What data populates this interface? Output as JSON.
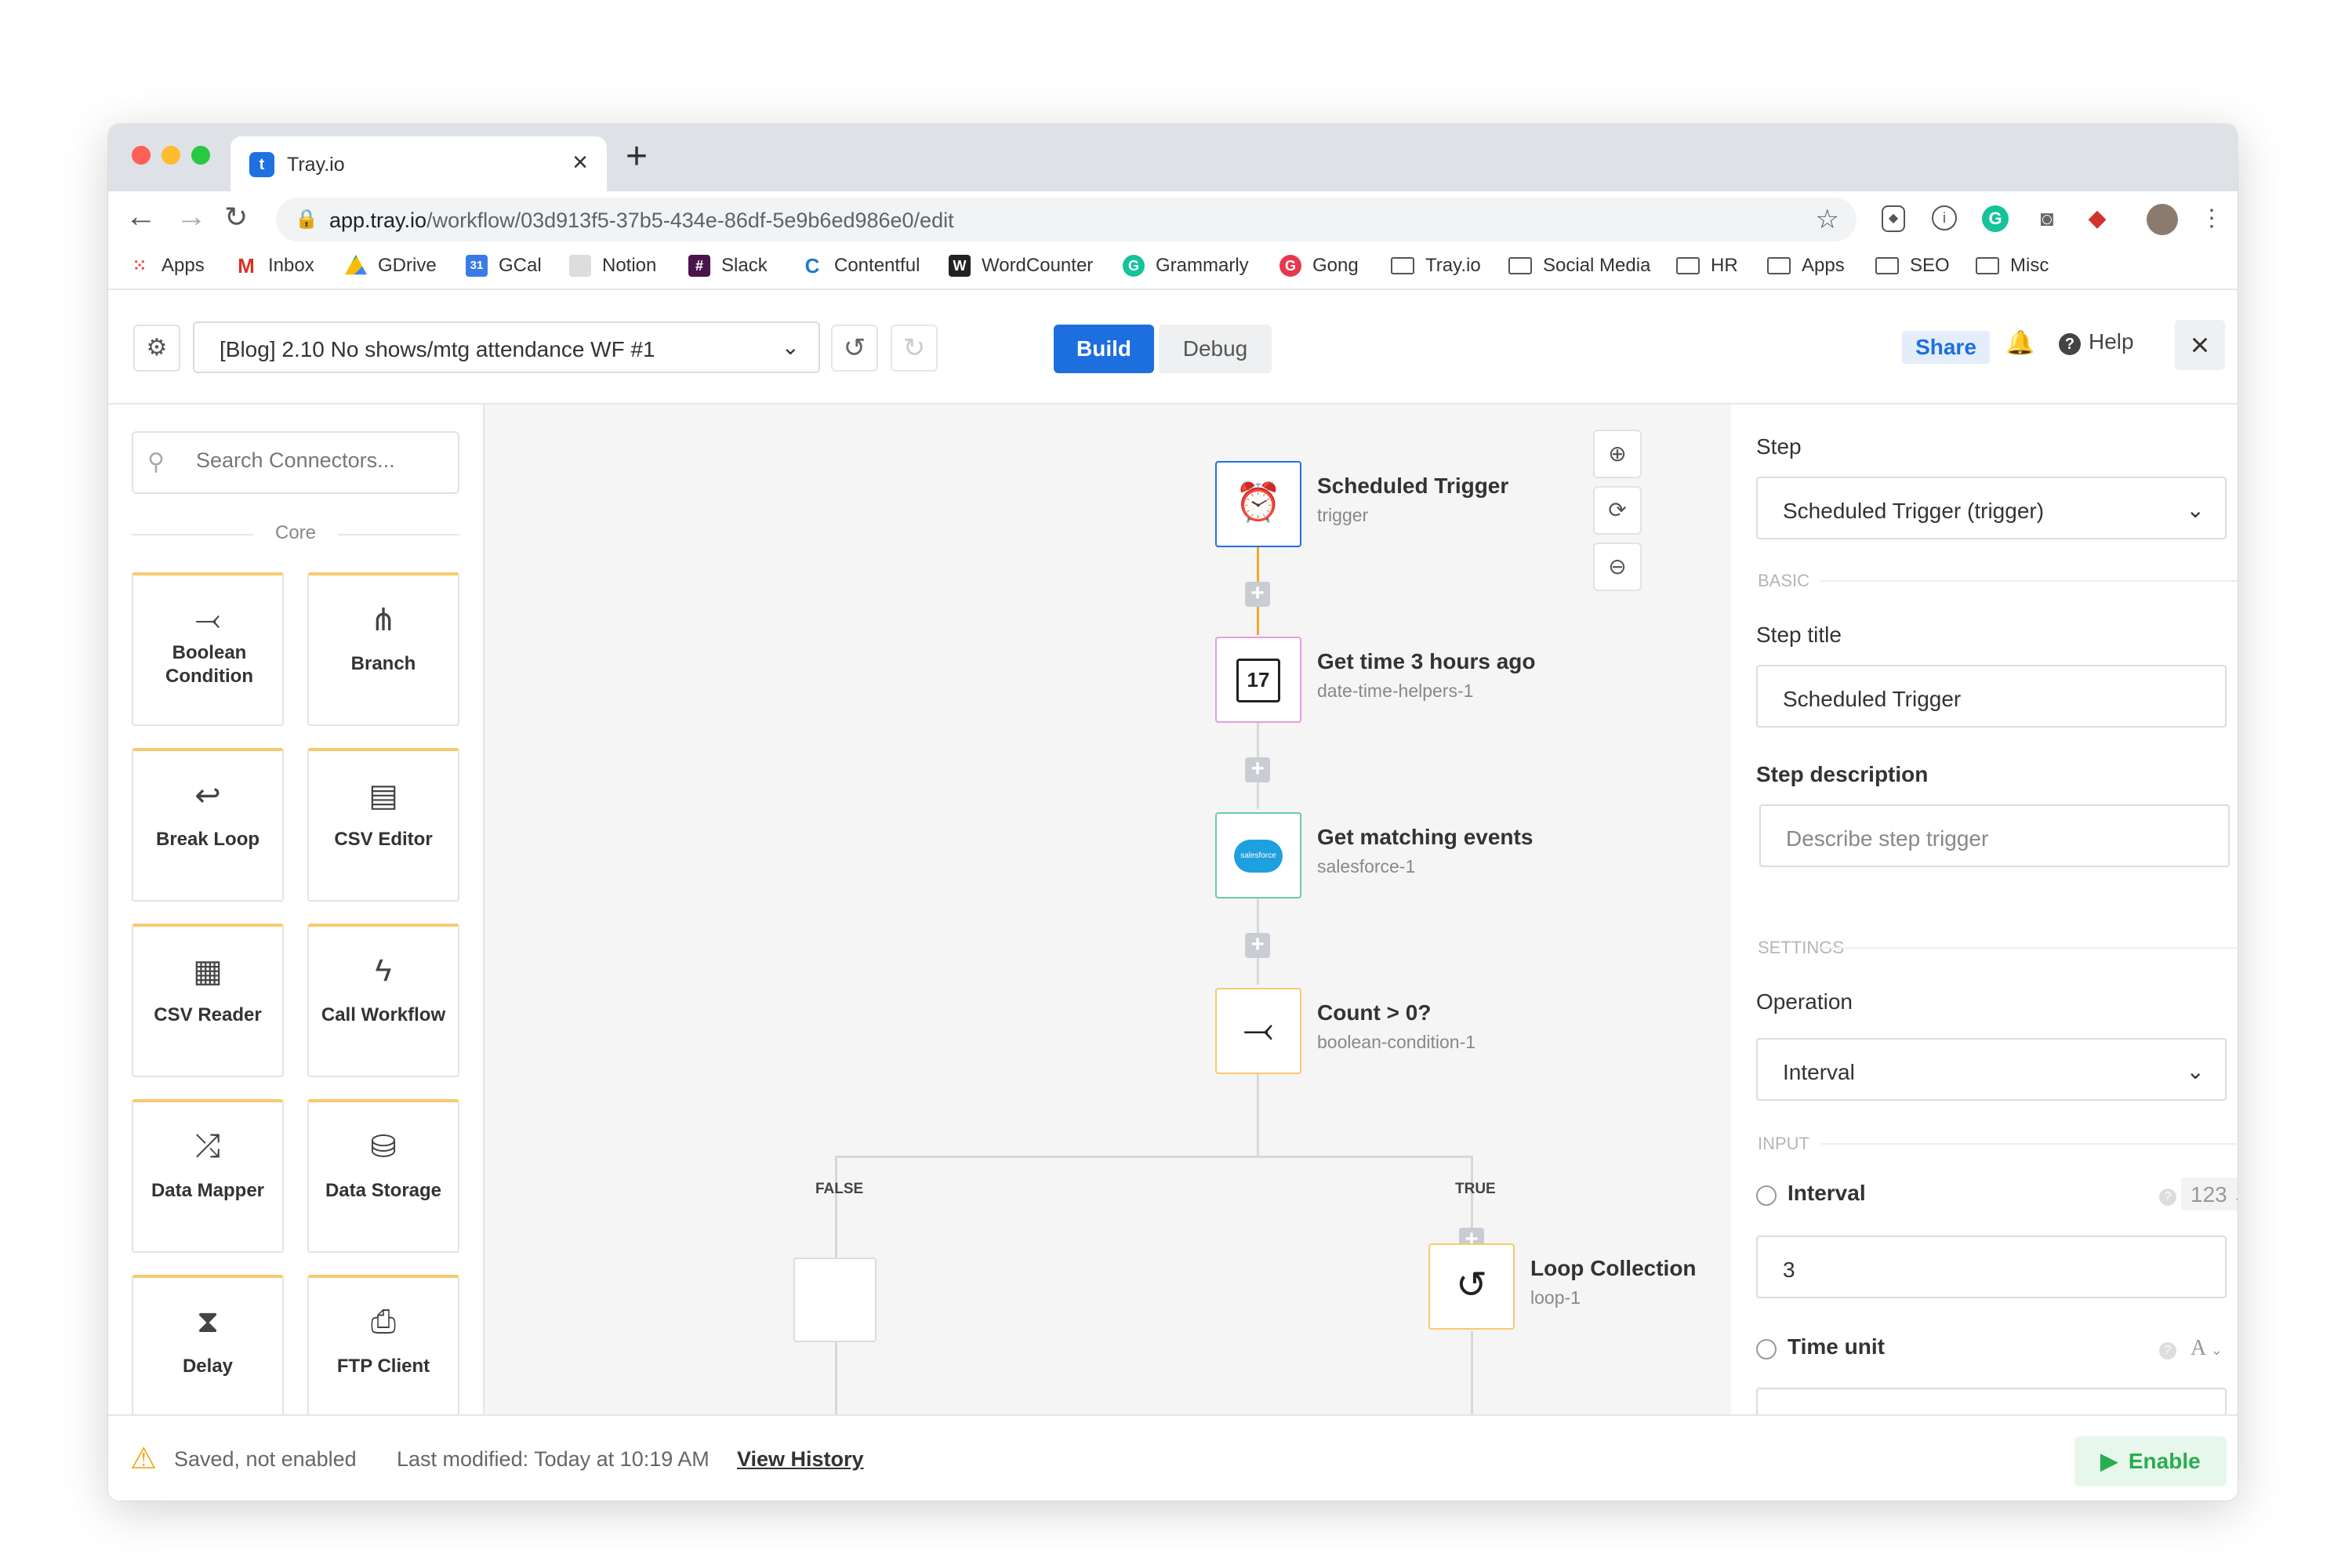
{
  "browser": {
    "tab_title": "Tray.io",
    "url_domain": "app.tray.io",
    "url_path": "/workflow/03d913f5-37b5-434e-86df-5e9b6ed986e0/edit",
    "bookmarks": [
      "Apps",
      "Inbox",
      "GDrive",
      "GCal",
      "Notion",
      "Slack",
      "Contentful",
      "WordCounter",
      "Grammarly",
      "Gong",
      "Tray.io",
      "Social Media",
      "HR",
      "Apps",
      "SEO",
      "Misc"
    ]
  },
  "header": {
    "workflow_name": "[Blog] 2.10 No shows/mtg attendance WF #1",
    "build_label": "Build",
    "debug_label": "Debug",
    "share_label": "Share",
    "help_label": "Help"
  },
  "sidebar": {
    "search_placeholder": "Search Connectors...",
    "section_label": "Core",
    "connectors": [
      {
        "label": "Boolean Condition",
        "icon": "boolean-icon"
      },
      {
        "label": "Branch",
        "icon": "branch-icon"
      },
      {
        "label": "Break Loop",
        "icon": "break-loop-icon"
      },
      {
        "label": "CSV Editor",
        "icon": "csv-editor-icon"
      },
      {
        "label": "CSV Reader",
        "icon": "csv-reader-icon"
      },
      {
        "label": "Call Workflow",
        "icon": "lightning-icon"
      },
      {
        "label": "Data Mapper",
        "icon": "shuffle-icon"
      },
      {
        "label": "Data Storage",
        "icon": "database-icon"
      },
      {
        "label": "Delay",
        "icon": "hourglass-icon"
      },
      {
        "label": "FTP Client",
        "icon": "ftp-icon"
      }
    ]
  },
  "canvas": {
    "steps": [
      {
        "title": "Scheduled Trigger",
        "sub": "trigger",
        "icon": "alarm-clock-icon"
      },
      {
        "title": "Get time 3 hours ago",
        "sub": "date-time-helpers-1",
        "icon": "calendar-icon"
      },
      {
        "title": "Get matching events",
        "sub": "salesforce-1",
        "icon": "salesforce-icon"
      },
      {
        "title": "Count > 0?",
        "sub": "boolean-condition-1",
        "icon": "boolean-icon"
      },
      {
        "title": "Loop Collection",
        "sub": "loop-1",
        "icon": "loop-icon"
      }
    ],
    "branch_false": "FALSE",
    "branch_true": "TRUE",
    "calendar_day": "17",
    "salesforce_text": "salesforce"
  },
  "panel": {
    "step_label": "Step",
    "step_value": "Scheduled Trigger (trigger)",
    "basic_label": "BASIC",
    "step_title_label": "Step title",
    "step_title_value": "Scheduled Trigger",
    "step_desc_label": "Step description",
    "step_desc_placeholder": "Describe step trigger",
    "settings_label": "SETTINGS",
    "operation_label": "Operation",
    "operation_value": "Interval",
    "input_label": "INPUT",
    "interval_label": "Interval",
    "interval_type": "123",
    "interval_value": "3",
    "time_unit_label": "Time unit",
    "time_unit_type": "A"
  },
  "footer": {
    "saved_status": "Saved, not enabled",
    "last_modified": "Last modified: Today at 10:19 AM",
    "view_history": "View History",
    "enable_label": "Enable"
  },
  "colors": {
    "accent": "#1d6fe0",
    "enable_green": "#27ae4f",
    "warning": "#f3a712",
    "connector_top": "#f9c96a"
  }
}
